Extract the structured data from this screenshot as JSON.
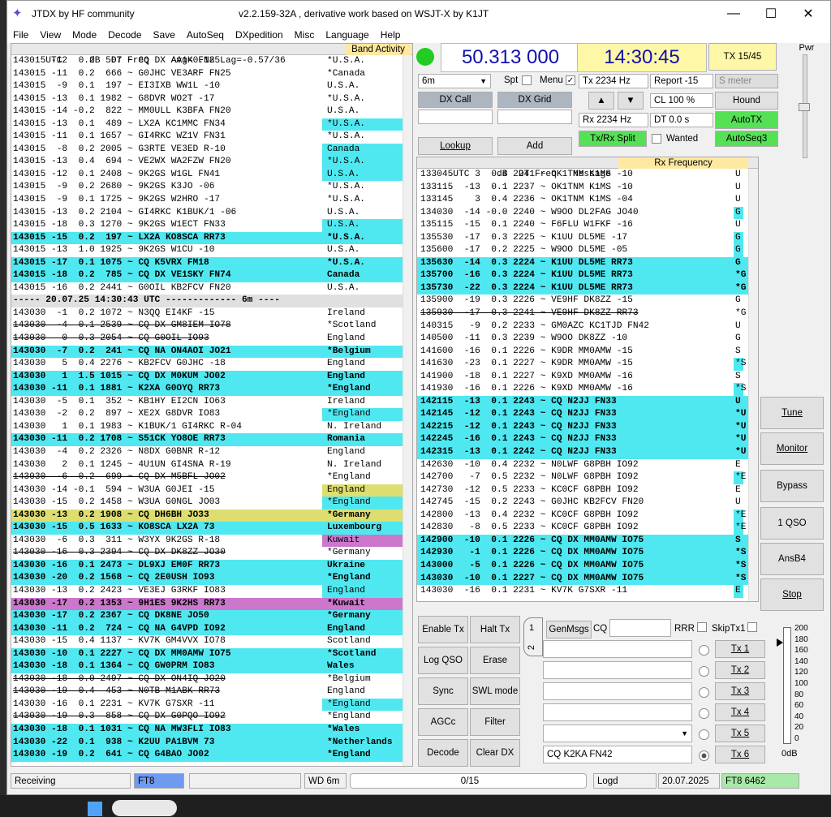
{
  "window": {
    "title": "JTDX   by HF community",
    "subtitle": "v2.2.159-32A , derivative work based on WSJT-X by K1JT"
  },
  "menu": [
    "File",
    "View",
    "Mode",
    "Decode",
    "Save",
    "AutoSeq",
    "DXpedition",
    "Misc",
    "Language",
    "Help"
  ],
  "left": {
    "header": "UTC     dB  DT Freq    Avg=0.18 Lag=-0.57/36",
    "band_activity": "Band Activity",
    "rows": [
      {
        "t": "143015 -12  0.2  507 ~ CQ DX AA1K FN25",
        "c": "*U.S.A."
      },
      {
        "t": "143015 -11  0.2  666 ~ G0JHC VE3ARF FN25",
        "c": "*Canada"
      },
      {
        "t": "143015  -9  0.1  197 ~ EI3IXB WW1L -10",
        "c": "U.S.A."
      },
      {
        "t": "143015 -13  0.1 1982 ~ G8DVR WO2T -17",
        "c": "*U.S.A."
      },
      {
        "t": "143015 -14 -0.2  822 ~ MM0ULL K3BFA FN20",
        "c": "U.S.A."
      },
      {
        "t": "143015 -13  0.1  489 ~ LX2A KC1MMC FN34",
        "c": "*U.S.A.",
        "h": 1
      },
      {
        "t": "143015 -11  0.1 1657 ~ GI4RKC WZ1V FN31",
        "c": "*U.S.A."
      },
      {
        "t": "143015  -8  0.2 2005 ~ G3RTE VE3ED R-10",
        "c": "Canada",
        "h": 1
      },
      {
        "t": "143015 -13  0.4  694 ~ VE2WX WA2FZW FN20",
        "c": "*U.S.A.",
        "h": 1
      },
      {
        "t": "143015 -12  0.1 2408 ~ 9K2GS W1GL FN41",
        "c": "U.S.A.",
        "h": 1
      },
      {
        "t": "143015  -9  0.2 2680 ~ 9K2GS K3JO -06",
        "c": "*U.S.A."
      },
      {
        "t": "143015  -9  0.1 1725 ~ 9K2GS W2HRO -17",
        "c": "*U.S.A."
      },
      {
        "t": "143015 -13  0.2 2104 ~ GI4RKC K1BUK/1 -06",
        "c": "U.S.A."
      },
      {
        "t": "143015 -18  0.3 1270 ~ 9K2GS W1ECT FN33",
        "c": "U.S.A.",
        "h": 1
      },
      {
        "t": "143015 -15  0.2  197 ~ LX2A KO8SCA RR73",
        "c": "*U.S.A.",
        "k": "cq"
      },
      {
        "t": "143015 -13  1.0 1925 ~ 9K2GS W1CU -10",
        "c": "U.S.A."
      },
      {
        "t": "143015 -17  0.1 1075 ~ CQ K5VRX FM18",
        "c": "*U.S.A.",
        "k": "cq"
      },
      {
        "t": "143015 -18  0.2  785 ~ CQ DX VE1SKY FN74",
        "c": "Canada",
        "k": "cq"
      },
      {
        "t": "143015 -16  0.2 2441 ~ G0OIL KB2FCV FN20",
        "c": "U.S.A."
      },
      {
        "t": "----- 20.07.25 14:30:43 UTC ------------- 6m ----",
        "c": "",
        "k": "sep"
      },
      {
        "t": "143030  -1  0.2 1072 ~ N3QQ EI4KF -15",
        "c": "Ireland"
      },
      {
        "t": "143030  -4  0.1 2539 ~ CQ DX GM8IEM IO78",
        "c": "*Scotland",
        "s": 1
      },
      {
        "t": "143030   0  0.3 2054 ~ CQ G0OIL IO93",
        "c": "England",
        "s": 1
      },
      {
        "t": "143030  -7  0.2  241 ~ CQ NA ON4AOI JO21",
        "c": "*Belgium",
        "k": "cq"
      },
      {
        "t": "143030   5  0.4 2276 ~ KB2FCV G0JHC -18",
        "c": "England"
      },
      {
        "t": "143030   1  1.5 1015 ~ CQ DX M0KUM JO02",
        "c": "England",
        "k": "cq"
      },
      {
        "t": "143030 -11  0.1 1881 ~ K2XA G0OYQ RR73",
        "c": "*England",
        "k": "cq"
      },
      {
        "t": "143030  -5  0.1  352 ~ KB1HY EI2CN IO63",
        "c": "Ireland"
      },
      {
        "t": "143030  -2  0.2  897 ~ XE2X G8DVR IO83",
        "c": "*England",
        "h": 1
      },
      {
        "t": "143030   1  0.1 1983 ~ K1BUK/1 GI4RKC R-04",
        "c": "N. Ireland"
      },
      {
        "t": "143030 -11  0.2 1708 ~ S51CK YO8OE RR73",
        "c": "Romania",
        "k": "cq"
      },
      {
        "t": "143030  -4  0.2 2326 ~ N8DX G0BNR R-12",
        "c": "England"
      },
      {
        "t": "143030   2  0.1 1245 ~ 4U1UN GI4SNA R-19",
        "c": "N. Ireland"
      },
      {
        "t": "143030  -6  0.2  699 ~ CQ DX M5BFL JO02",
        "c": "*England",
        "s": 1
      },
      {
        "t": "143030 -14 -0.1  594 ~ W3UA G0JEI -15",
        "c": "England",
        "h": 2
      },
      {
        "t": "143030 -15  0.2 1458 ~ W3UA G0NGL JO03",
        "c": "*England",
        "h": 1
      },
      {
        "t": "143030 -13  0.2 1908 ~ CQ DH6BH JO33",
        "c": "*Germany",
        "k": "ylw"
      },
      {
        "t": "143030 -15  0.5 1633 ~ KO8SCA LX2A 73",
        "c": "Luxembourg",
        "k": "cq"
      },
      {
        "t": "143030  -6  0.3  311 ~ W3YX 9K2GS R-18",
        "c": "Kuwait",
        "h": 3
      },
      {
        "t": "143030 -16  0.3 2394 ~ CQ DX DK8ZZ JO30",
        "c": "*Germany",
        "s": 1
      },
      {
        "t": "143030 -16  0.1 2473 ~ DL9XJ EM0F RR73",
        "c": "Ukraine",
        "k": "cq"
      },
      {
        "t": "143030 -20  0.2 1568 ~ CQ 2E0USH IO93",
        "c": "*England",
        "k": "cq"
      },
      {
        "t": "143030 -13  0.2 2423 ~ VE3EJ G3RKF IO83",
        "c": "England",
        "h": 1
      },
      {
        "t": "143030 -17  0.2 1353 ~ 9H1ES 9K2HS RR73",
        "c": "*Kuwait",
        "k": "mag"
      },
      {
        "t": "143030 -17  0.2 2367 ~ CQ DK8NE JO50",
        "c": "*Germany",
        "k": "cq"
      },
      {
        "t": "143030 -11  0.2  724 ~ CQ NA G4VPD IO92",
        "c": "England",
        "k": "cq"
      },
      {
        "t": "143030 -15  0.4 1137 ~ KV7K GM4VVX IO78",
        "c": "Scotland"
      },
      {
        "t": "143030 -10  0.1 2227 ~ CQ DX MM0AMW IO75",
        "c": "*Scotland",
        "k": "cq"
      },
      {
        "t": "143030 -18  0.1 1364 ~ CQ GW0PRM IO83",
        "c": "Wales",
        "k": "cq"
      },
      {
        "t": "143030 -18  0.0 2497 ~ CQ DX ON4IQ JO20",
        "c": "*Belgium",
        "s": 1
      },
      {
        "t": "143030 -19  0.4  453 ~ N0TB M1ABK RR73",
        "c": "England",
        "s": 1
      },
      {
        "t": "143030 -16  0.1 2231 ~ KV7K G7SXR -11",
        "c": "*England",
        "h": 1
      },
      {
        "t": "143030 -19  0.3  858 ~ CQ DX G0PQO IO92",
        "c": "*England",
        "s": 1
      },
      {
        "t": "143030 -18  0.1 1031 ~ CQ NA MW3FLI IO83",
        "c": "*Wales",
        "k": "cq"
      },
      {
        "t": "143030 -22  0.1  938 ~ K2UU PA1BVM 73",
        "c": "*Netherlands",
        "k": "cq"
      },
      {
        "t": "143030 -19  0.2  641 ~ CQ G4BAO JO02",
        "c": "*England",
        "k": "cq"
      }
    ]
  },
  "top": {
    "freq": "50.313 000",
    "time": "14:30:45",
    "tx_btn": "TX 15/45",
    "band": "6m",
    "spt": "Spt",
    "menu_lbl": "Menu",
    "tx_hz": "Tx  2234 Hz",
    "rx_hz": "Rx  2234 Hz",
    "report": "Report -15",
    "smeter": "S meter",
    "cl": "CL  100 %",
    "dt": "DT 0.0 s",
    "hound": "Hound",
    "autotx": "AutoTX",
    "autoseq": "AutoSeq3",
    "dxcall": "DX Call",
    "dxgrid": "DX Grid",
    "lookup": "Lookup",
    "add": "Add",
    "txrxsplit": "Tx/Rx Split",
    "wanted": "Wanted",
    "up": "▲",
    "down": "▼",
    "pwr": "Pwr"
  },
  "right": {
    "header": "UTC     dB  DT Freq   Message",
    "rxfreq": "Rx Frequency",
    "rows": [
      {
        "t": "133045    3  0.4 2241 ~ OK1TNM K1MS -10",
        "c": "U"
      },
      {
        "t": "133115  -13  0.1 2237 ~ OK1TNM K1MS -10",
        "c": "U"
      },
      {
        "t": "133145    3  0.4 2236 ~ OK1TNM K1MS -04",
        "c": "U"
      },
      {
        "t": "134030  -14 -0.0 2240 ~ W9OO DL2FAG JO40",
        "c": "G",
        "h": 1
      },
      {
        "t": "135115  -15  0.1 2240 ~ F6FLU W1FKF -16",
        "c": "U"
      },
      {
        "t": "135530  -17  0.3 2225 ~ K1UU DL5ME -17",
        "c": "G",
        "h": 1
      },
      {
        "t": "135600  -17  0.2 2225 ~ W9OO DL5ME -05",
        "c": "G",
        "h": 1
      },
      {
        "t": "135630  -14  0.3 2224 ~ K1UU DL5ME RR73",
        "c": "G",
        "k": "cq"
      },
      {
        "t": "135700  -16  0.3 2224 ~ K1UU DL5ME RR73",
        "c": "*G",
        "k": "cq"
      },
      {
        "t": "135730  -22  0.3 2224 ~ K1UU DL5ME RR73",
        "c": "*G",
        "k": "cq"
      },
      {
        "t": "135900  -19  0.3 2226 ~ VE9HF DK8ZZ -15",
        "c": "G"
      },
      {
        "t": "135930  -17  0.3 2241 ~ VE9HF DK8ZZ RR73",
        "c": "*G",
        "s": 1
      },
      {
        "t": "140315   -9  0.2 2233 ~ GM0AZC KC1TJD FN42",
        "c": "U"
      },
      {
        "t": "140500  -11  0.3 2239 ~ W9OO DK8ZZ -10",
        "c": "G"
      },
      {
        "t": "141600  -16  0.1 2226 ~ K9DR MM0AMW -15",
        "c": "S"
      },
      {
        "t": "141630  -23  0.1 2227 ~ K9DR MM0AMW -15",
        "c": "*S",
        "h": 1
      },
      {
        "t": "141900  -18  0.1 2227 ~ K9XD MM0AMW -16",
        "c": "S"
      },
      {
        "t": "141930  -16  0.1 2226 ~ K9XD MM0AMW -16",
        "c": "*S",
        "h": 1
      },
      {
        "t": "142115  -13  0.1 2243 ~ CQ N2JJ FN33",
        "c": "U",
        "k": "cq"
      },
      {
        "t": "142145  -12  0.1 2243 ~ CQ N2JJ FN33",
        "c": "*U",
        "k": "cq"
      },
      {
        "t": "142215  -12  0.1 2243 ~ CQ N2JJ FN33",
        "c": "*U",
        "k": "cq"
      },
      {
        "t": "142245  -16  0.1 2243 ~ CQ N2JJ FN33",
        "c": "*U",
        "k": "cq"
      },
      {
        "t": "142315  -13  0.1 2242 ~ CQ N2JJ FN33",
        "c": "*U",
        "k": "cq"
      },
      {
        "t": "142630  -10  0.4 2232 ~ N0LWF G8PBH IO92",
        "c": "E"
      },
      {
        "t": "142700   -7  0.5 2232 ~ N0LWF G8PBH IO92",
        "c": "*E",
        "h": 1
      },
      {
        "t": "142730  -12  0.5 2233 ~ KC0CF G8PBH IO92",
        "c": "E"
      },
      {
        "t": "142745  -15  0.2 2243 ~ G0JHC KB2FCV FN20",
        "c": "U"
      },
      {
        "t": "142800  -13  0.4 2232 ~ KC0CF G8PBH IO92",
        "c": "*E",
        "h": 1
      },
      {
        "t": "142830   -8  0.5 2233 ~ KC0CF G8PBH IO92",
        "c": "*E",
        "h": 1
      },
      {
        "t": "142900  -10  0.1 2226 ~ CQ DX MM0AMW IO75",
        "c": "S",
        "k": "cq"
      },
      {
        "t": "142930   -1  0.1 2226 ~ CQ DX MM0AMW IO75",
        "c": "*S",
        "k": "cq"
      },
      {
        "t": "143000   -5  0.1 2226 ~ CQ DX MM0AMW IO75",
        "c": "*S",
        "k": "cq"
      },
      {
        "t": "143030  -10  0.1 2227 ~ CQ DX MM0AMW IO75",
        "c": "*S",
        "k": "cq"
      },
      {
        "t": "143030  -16  0.1 2231 ~ KV7K G7SXR -11",
        "c": "E",
        "h": 1
      }
    ]
  },
  "controls": {
    "enable_tx": "Enable Tx",
    "halt_tx": "Halt Tx",
    "log_qso": "Log QSO",
    "erase": "Erase",
    "sync": "Sync",
    "swl_mode": "SWL mode",
    "agcc": "AGCc",
    "filter": "Filter",
    "decode": "Decode",
    "clear_dx": "Clear DX",
    "genmsgs": "GenMsgs",
    "cq": "CQ",
    "rrr": "RRR",
    "skiptx1": "SkipTx1",
    "tx_buttons": [
      "Tx 1",
      "Tx 2",
      "Tx 3",
      "Tx 4",
      "Tx 5",
      "Tx 6"
    ],
    "tx6_msg": "CQ K2KA FN42",
    "tab1": "1",
    "tab2": "2"
  },
  "side_buttons": [
    "Tune",
    "Monitor",
    "Bypass",
    "1 QSO",
    "AnsB4",
    "Stop"
  ],
  "meter": {
    "ticks": [
      "200",
      "180",
      "160",
      "140",
      "120",
      "100",
      "80",
      "60",
      "40",
      "20",
      "0"
    ],
    "unit": "0dB"
  },
  "status": {
    "receiving": "Receiving",
    "mode": "FT8",
    "wd": "WD 6m",
    "progress": "0/15",
    "logd": "Logd",
    "date": "20.07.2025",
    "ft8": "FT8  6462"
  },
  "colors": {
    "cq": "#50e8f0",
    "green": "#55e055",
    "yellow": "#fff7a8",
    "magenta": "#cc77cc",
    "freq_text": "#1010b0"
  }
}
